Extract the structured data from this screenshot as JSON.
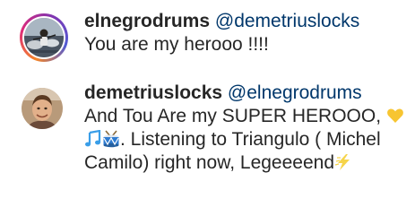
{
  "comments": [
    {
      "username": "elnegrodrums",
      "mention": "@demetriuslocks",
      "text": "You are my herooo !!!!",
      "avatar": "drummer-profile-photo"
    },
    {
      "username": "demetriuslocks",
      "mention": "@elnegrodrums",
      "text_parts": [
        "And Tou Are my SUPER HEROOO,",
        ". Listening to Triangulo ( Michel Camilo) right now, Legeeeend"
      ],
      "emojis": [
        "yellow-heart-icon",
        "musical-notes-icon",
        "drum-icon",
        "lightning-icon"
      ],
      "avatar": "man-profile-photo"
    }
  ],
  "colors": {
    "text": "#262626",
    "mention": "#00376b",
    "heart": "#f7c531",
    "notes": "#3a9ee8",
    "drum": "#2e7bd0"
  }
}
